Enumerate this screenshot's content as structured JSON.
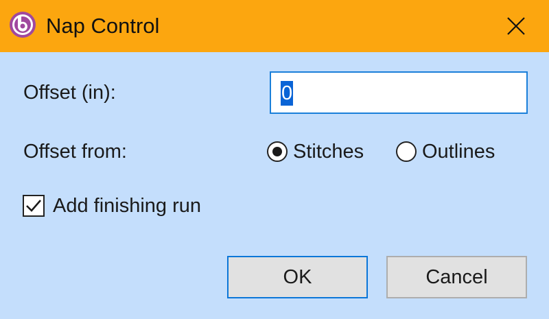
{
  "window": {
    "title": "Nap Control",
    "app_icon": "app-logo-icon",
    "close_icon": "close-icon"
  },
  "form": {
    "offset_label": "Offset (in):",
    "offset_value": "0",
    "offset_from_label": "Offset from:",
    "radio_options": [
      {
        "label": "Stitches",
        "selected": true
      },
      {
        "label": "Outlines",
        "selected": false
      }
    ],
    "finishing_run_label": "Add finishing run",
    "finishing_run_checked": true
  },
  "buttons": {
    "ok": "OK",
    "cancel": "Cancel"
  },
  "colors": {
    "titlebar": "#fca60f",
    "background": "#c4defc",
    "focus_border": "#1a7fd9",
    "selection": "#0a64d6",
    "app_icon": "#a0489e"
  }
}
